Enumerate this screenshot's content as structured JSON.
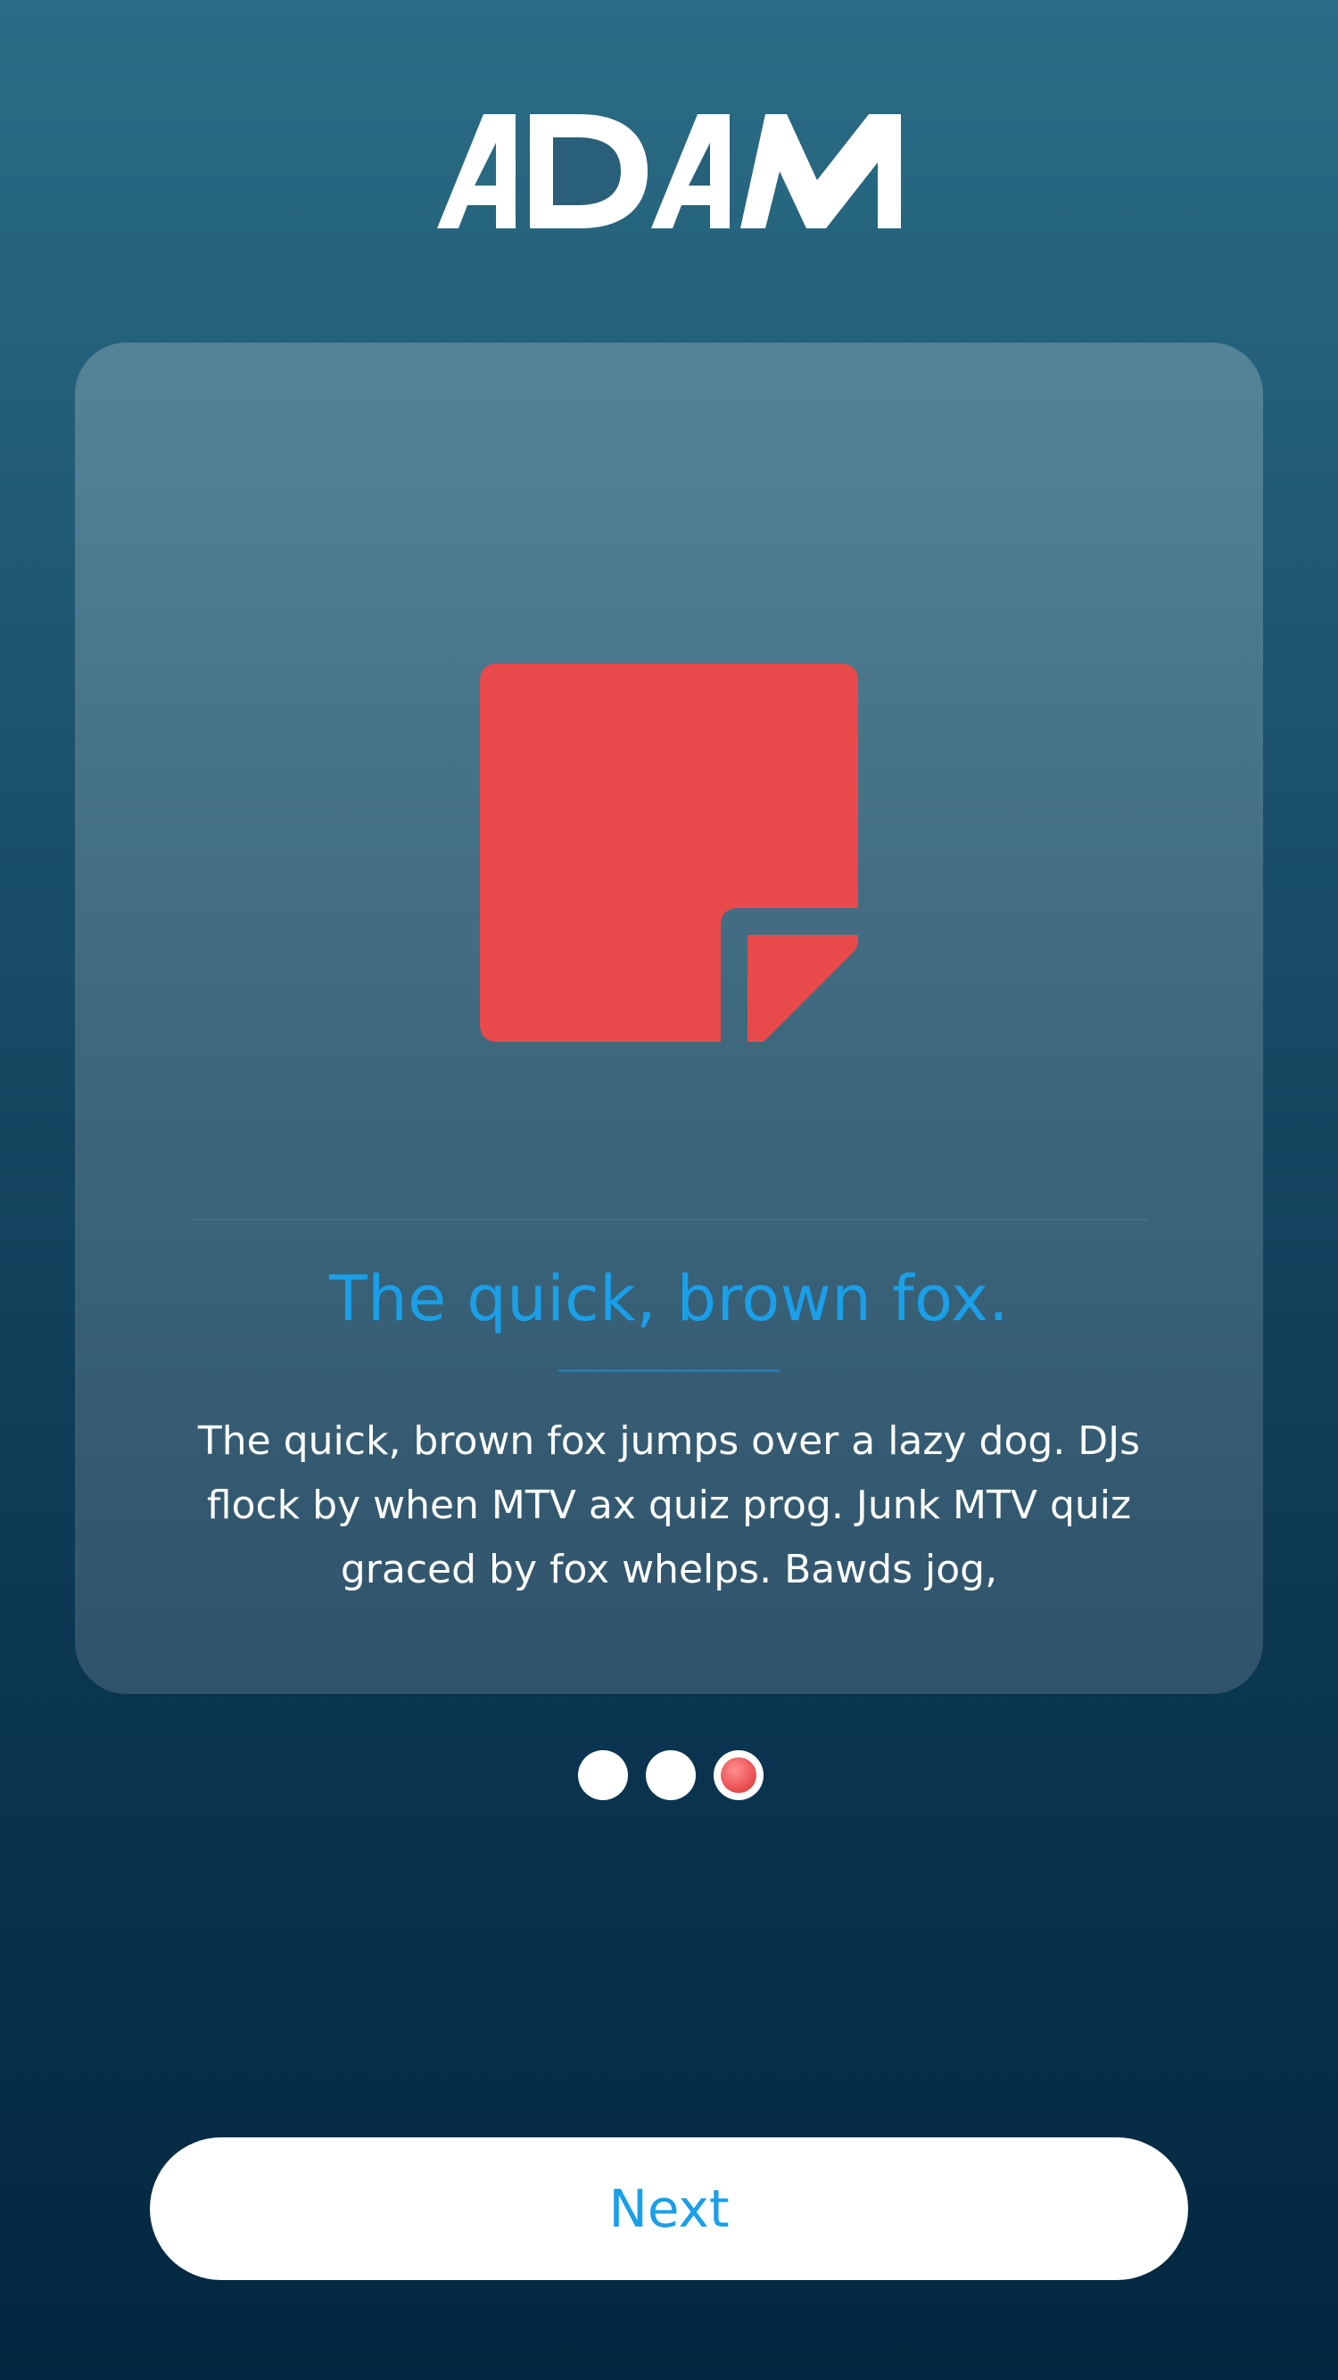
{
  "app": {
    "logo_text": "ADAM"
  },
  "onboarding": {
    "icon": "note-icon",
    "title": "The quick, brown fox.",
    "body": "The quick, brown fox jumps over a lazy dog. DJs flock by when MTV ax quiz prog. Junk MTV quiz graced by fox whelps. Bawds jog,",
    "pages_total": 3,
    "current_page": 3
  },
  "actions": {
    "next_label": "Next"
  },
  "colors": {
    "accent_blue": "#1a9fe8",
    "icon_red": "#e84a4b",
    "background_top": "#2b6d86",
    "background_bottom": "#032740"
  }
}
